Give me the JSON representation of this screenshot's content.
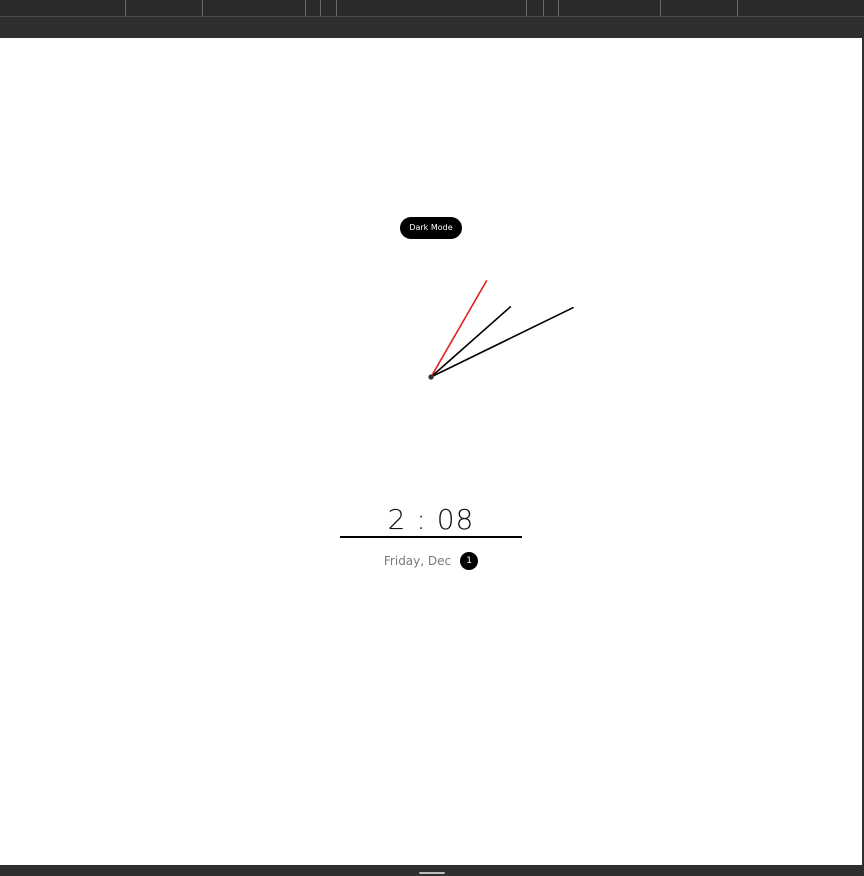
{
  "theme_toggle": {
    "label": "Dark Mode"
  },
  "clock": {
    "hour": 2,
    "minute": 8,
    "second": 5,
    "hand_colors": {
      "hour": "#000000",
      "minute": "#000000",
      "second": "#e11d1d"
    }
  },
  "digital": {
    "time": "2 : 08",
    "date_label": "Friday, Dec",
    "day": "1"
  },
  "colors": {
    "chrome": "#2f2f31",
    "background": "#ffffff",
    "accent": "#000000"
  }
}
